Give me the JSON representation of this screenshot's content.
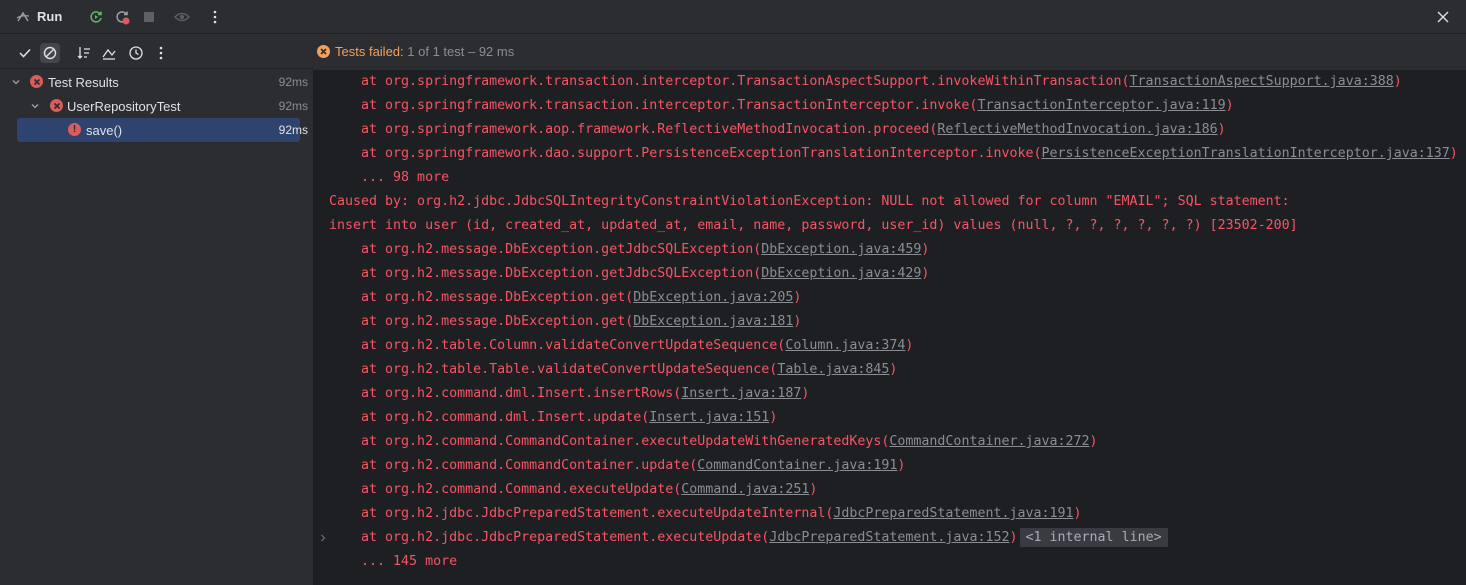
{
  "titlebar": {
    "title": "Run"
  },
  "status": {
    "failed_label": "Tests failed:",
    "rest": " 1 of 1 test – 92 ms"
  },
  "tree": [
    {
      "label": "Test Results",
      "time": "92ms"
    },
    {
      "label": "UserRepositoryTest",
      "time": "92ms"
    },
    {
      "label": "save()",
      "time": "92ms"
    }
  ],
  "console": {
    "lines": [
      {
        "indent": "    ",
        "text": "at org.springframework.transaction.interceptor.TransactionAspectSupport.invokeWithinTransaction(",
        "link": "TransactionAspectSupport.java:388",
        "tail": ")"
      },
      {
        "indent": "    ",
        "text": "at org.springframework.transaction.interceptor.TransactionInterceptor.invoke(",
        "link": "TransactionInterceptor.java:119",
        "tail": ")"
      },
      {
        "indent": "    ",
        "text": "at org.springframework.aop.framework.ReflectiveMethodInvocation.proceed(",
        "link": "ReflectiveMethodInvocation.java:186",
        "tail": ")"
      },
      {
        "indent": "    ",
        "text": "at org.springframework.dao.support.PersistenceExceptionTranslationInterceptor.invoke(",
        "link": "PersistenceExceptionTranslationInterceptor.java:137",
        "tail": ")"
      },
      {
        "indent": "    ",
        "text": "... 98 more",
        "link": "",
        "tail": ""
      },
      {
        "indent": "",
        "text": "Caused by: org.h2.jdbc.JdbcSQLIntegrityConstraintViolationException: NULL not allowed for column \"EMAIL\"; SQL statement:",
        "link": "",
        "tail": ""
      },
      {
        "indent": "",
        "text": "insert into user (id, created_at, updated_at, email, name, password, user_id) values (null, ?, ?, ?, ?, ?, ?) [23502-200]",
        "link": "",
        "tail": ""
      },
      {
        "indent": "    ",
        "text": "at org.h2.message.DbException.getJdbcSQLException(",
        "link": "DbException.java:459",
        "tail": ")"
      },
      {
        "indent": "    ",
        "text": "at org.h2.message.DbException.getJdbcSQLException(",
        "link": "DbException.java:429",
        "tail": ")"
      },
      {
        "indent": "    ",
        "text": "at org.h2.message.DbException.get(",
        "link": "DbException.java:205",
        "tail": ")"
      },
      {
        "indent": "    ",
        "text": "at org.h2.message.DbException.get(",
        "link": "DbException.java:181",
        "tail": ")"
      },
      {
        "indent": "    ",
        "text": "at org.h2.table.Column.validateConvertUpdateSequence(",
        "link": "Column.java:374",
        "tail": ")"
      },
      {
        "indent": "    ",
        "text": "at org.h2.table.Table.validateConvertUpdateSequence(",
        "link": "Table.java:845",
        "tail": ")"
      },
      {
        "indent": "    ",
        "text": "at org.h2.command.dml.Insert.insertRows(",
        "link": "Insert.java:187",
        "tail": ")"
      },
      {
        "indent": "    ",
        "text": "at org.h2.command.dml.Insert.update(",
        "link": "Insert.java:151",
        "tail": ")"
      },
      {
        "indent": "    ",
        "text": "at org.h2.command.CommandContainer.executeUpdateWithGeneratedKeys(",
        "link": "CommandContainer.java:272",
        "tail": ")"
      },
      {
        "indent": "    ",
        "text": "at org.h2.command.CommandContainer.update(",
        "link": "CommandContainer.java:191",
        "tail": ")"
      },
      {
        "indent": "    ",
        "text": "at org.h2.command.Command.executeUpdate(",
        "link": "Command.java:251",
        "tail": ")"
      },
      {
        "indent": "    ",
        "text": "at org.h2.jdbc.JdbcPreparedStatement.executeUpdateInternal(",
        "link": "JdbcPreparedStatement.java:191",
        "tail": ")"
      },
      {
        "indent": "    ",
        "text": "at org.h2.jdbc.JdbcPreparedStatement.executeUpdate(",
        "link": "JdbcPreparedStatement.java:152",
        "tail": ")",
        "badge": "<1 internal line>"
      },
      {
        "indent": "    ",
        "text": "... 145 more",
        "link": "",
        "tail": ""
      }
    ]
  },
  "colors": {
    "error_text": "#f75464",
    "link_text": "#8a8d93",
    "fail_orange": "#f0a15f",
    "selection": "#2e436e",
    "error_icon": "#db5c5c"
  }
}
